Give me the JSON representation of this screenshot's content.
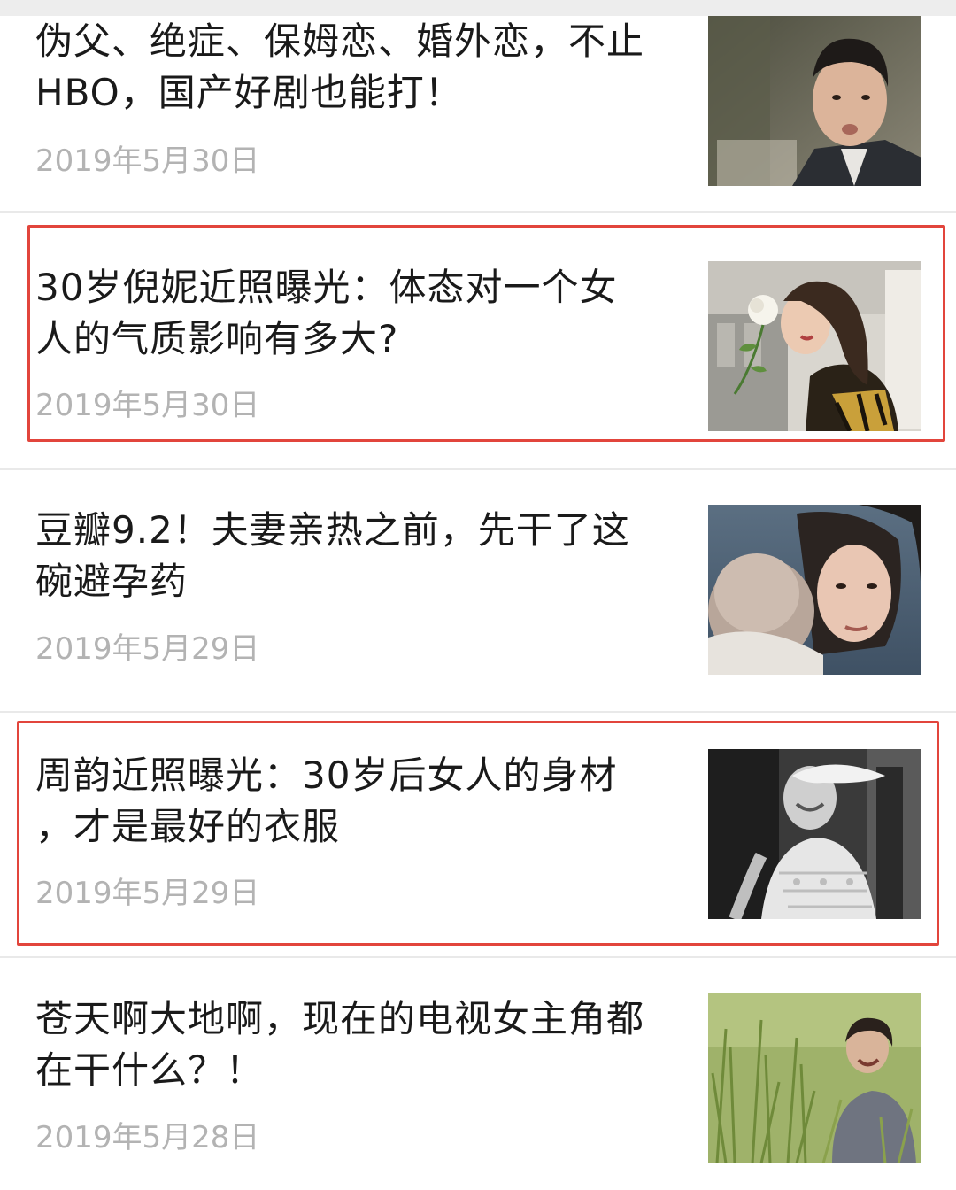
{
  "articles": [
    {
      "title": "伪父、绝症、保姆恋、婚外恋，不止\nHBO，国产好剧也能打！",
      "date": "2019年5月30日",
      "thumb_icon": "portrait-man-in-suit-image",
      "highlighted": false
    },
    {
      "title": "30岁倪妮近照曝光：体态对一个女\n人的气质影响有多大?",
      "date": "2019年5月30日",
      "thumb_icon": "woman-smelling-white-rose-image",
      "highlighted": true
    },
    {
      "title": "豆瓣9.2！夫妻亲热之前，先干了这\n碗避孕药",
      "date": "2019年5月29日",
      "thumb_icon": "woman-holding-baby-image",
      "highlighted": false
    },
    {
      "title": "周韵近照曝光：30岁后女人的身材\n，才是最好的衣服",
      "date": "2019年5月29日",
      "thumb_icon": "black-white-woman-in-hat-image",
      "highlighted": true
    },
    {
      "title": "苍天啊大地啊，现在的电视女主角都\n在干什么？！",
      "date": "2019年5月28日",
      "thumb_icon": "woman-crying-in-grass-image",
      "highlighted": false
    }
  ],
  "colors": {
    "title": "#1a1a1a",
    "date": "#b3b3b3",
    "highlight_border": "#e2453c",
    "divider": "#e9e9e9"
  }
}
